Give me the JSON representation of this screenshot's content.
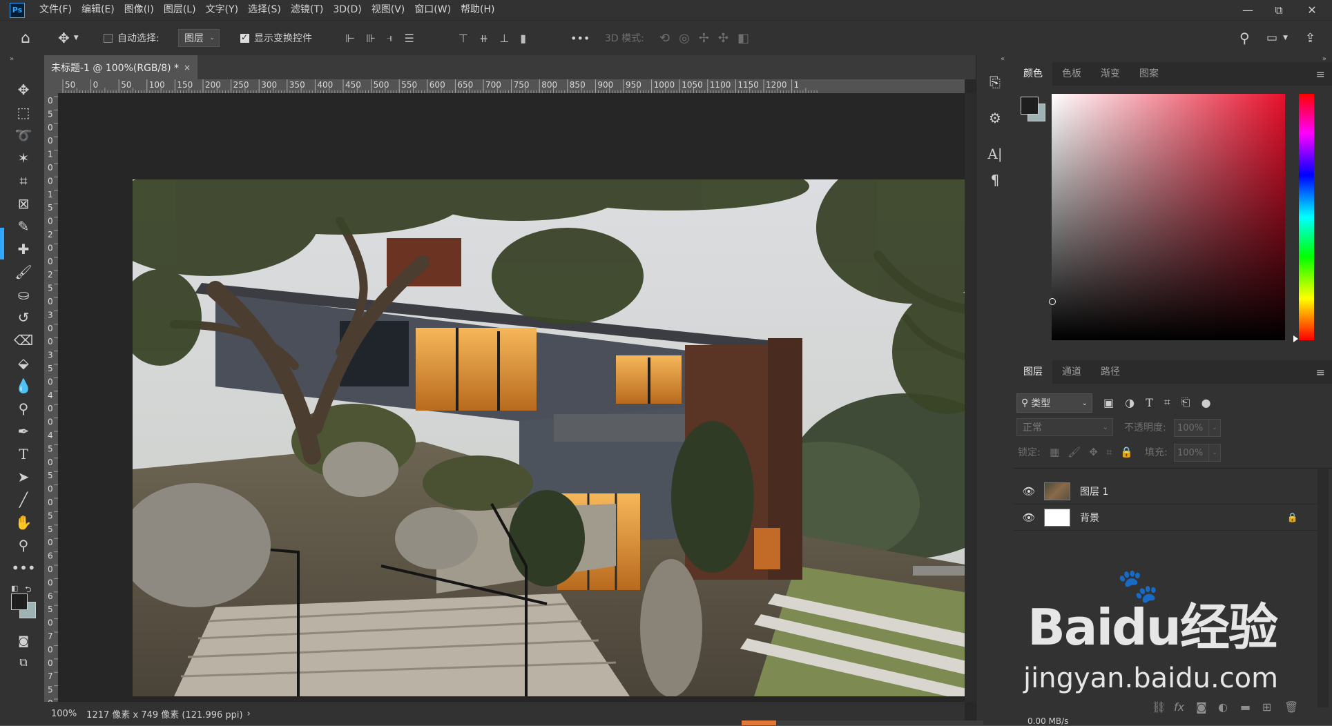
{
  "app": {
    "logo": "Ps",
    "menu": [
      "文件(F)",
      "编辑(E)",
      "图像(I)",
      "图层(L)",
      "文字(Y)",
      "选择(S)",
      "滤镜(T)",
      "3D(D)",
      "视图(V)",
      "窗口(W)",
      "帮助(H)"
    ],
    "window_controls": {
      "minimize": "—",
      "restore": "⧉",
      "close": "✕"
    }
  },
  "options_bar": {
    "auto_select_label": "自动选择:",
    "auto_select_checked": false,
    "target_value": "图层",
    "show_transform_label": "显示变换控件",
    "show_transform_checked": true,
    "more": "•••",
    "mode_3d_label": "3D 模式:"
  },
  "document": {
    "tab_title": "未标题-1 @ 100%(RGB/8) *",
    "tab_close": "×",
    "zoom": "100%",
    "status": "1217 像素 x 749 像素 (121.996 ppi)",
    "status_arrow": "›",
    "ruler_h": [
      "50",
      "0",
      "50",
      "100",
      "150",
      "200",
      "250",
      "300",
      "350",
      "400",
      "450",
      "500",
      "550",
      "600",
      "650",
      "700",
      "750",
      "800",
      "850",
      "900",
      "950",
      "1000",
      "1050",
      "1100",
      "1150",
      "1200",
      "1"
    ],
    "ruler_v": [
      "0",
      "5",
      "0",
      "0",
      "1",
      "0",
      "0",
      "1",
      "5",
      "0",
      "2",
      "0",
      "0",
      "2",
      "5",
      "0",
      "3",
      "0",
      "0",
      "3",
      "5",
      "0",
      "4",
      "0",
      "0",
      "4",
      "5",
      "0",
      "5",
      "0",
      "0",
      "5",
      "5",
      "0",
      "6",
      "0",
      "0",
      "6",
      "5",
      "0",
      "7",
      "0",
      "0",
      "7",
      "5",
      "0",
      "8"
    ]
  },
  "color_panel": {
    "tabs": [
      "颜色",
      "色板",
      "渐变",
      "图案"
    ],
    "active_tab": 0,
    "hue_color": "#e8102c",
    "foreground": "#1e1e1e",
    "background": "#9fb3b4"
  },
  "layers_panel": {
    "tabs": [
      "图层",
      "通道",
      "路径"
    ],
    "active_tab": 0,
    "filter_label": "类型",
    "blend_mode": "正常",
    "opacity_label": "不透明度:",
    "opacity_value": "100%",
    "lock_label": "锁定:",
    "fill_label": "填充:",
    "fill_value": "100%",
    "layers": [
      {
        "name": "图层 1",
        "visible": true,
        "locked": false,
        "thumb": "photo"
      },
      {
        "name": "背景",
        "visible": true,
        "locked": true,
        "thumb": "white"
      }
    ],
    "scratch_label": "0.00 MB/s"
  },
  "watermark": {
    "brand": "Baidu经验",
    "url": "jingyan.baidu.com"
  }
}
